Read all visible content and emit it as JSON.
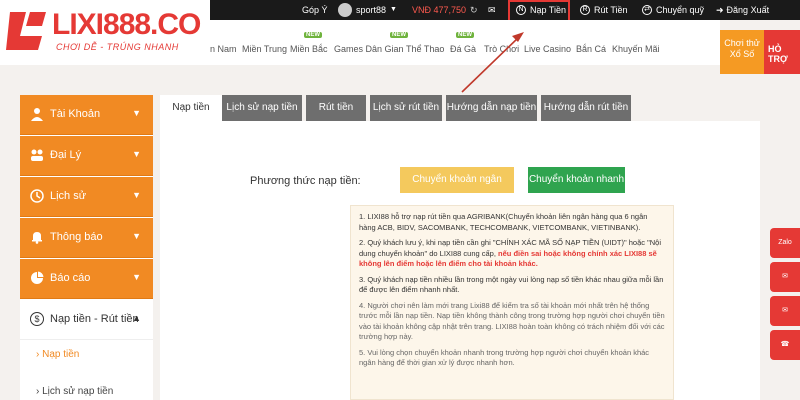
{
  "topbar": {
    "feedback": "Góp Ý",
    "username": "sport88",
    "balance": "VNĐ 477,750",
    "deposit": "Nạp Tiền",
    "withdraw": "Rút Tiền",
    "transfer": "Chuyển quỹ",
    "logout": "Đăng Xuất"
  },
  "logo": {
    "brand": "LIXI888.CO",
    "tagline": "CHƠI DỄ - TRÚNG NHANH"
  },
  "mainnav": {
    "items": [
      "n Nam",
      "Miền Trung",
      "Miền Bắc",
      "Games Dân Gian",
      "Thể Thao",
      "Đá Gà",
      "Trò Chơi",
      "Live Casino",
      "Bắn Cá",
      "Khuyến Mãi"
    ],
    "new_tag": "NEW"
  },
  "promo": {
    "tile1": "Chơi thử Xổ Số",
    "tile2": "HỎ TRỢ"
  },
  "sidebar": {
    "items": [
      "Tài Khoản",
      "Đại Lý",
      "Lịch sử",
      "Thông báo",
      "Báo cáo"
    ],
    "open_item": "Nạp tiền - Rút tiền",
    "sub_active": "Nạp tiền",
    "sub_next": "Lịch sử nạp tiền"
  },
  "tabs": {
    "active": "Nạp tiền",
    "items": [
      "Lịch sử nạp tiền",
      "Rút tiền",
      "Lịch sử rút tiền",
      "Hướng dẫn nạp tiền",
      "Hướng dẫn rút tiền"
    ]
  },
  "content": {
    "method_label": "Phương thức nạp tiền:",
    "btn_bank": "Chuyển khoản ngân hàng",
    "btn_fast": "Chuyển khoản nhanh",
    "notes": {
      "n1": "1. LIXI88 hỗ trợ nạp rút tiền qua AGRIBANK(Chuyển khoản liên ngân hàng qua 6 ngân hàng ACB, BIDV, SACOMBANK, TECHCOMBANK, VIETCOMBANK, VIETINBANK).",
      "n2a": "2. Quý khách lưu ý, khi nạp tiền cần ghi \"CHÍNH XÁC MÃ SỐ NẠP TIỀN (UIDT)\" hoặc \"Nội dung chuyển khoản\" do LIXI88 cung cấp, ",
      "n2b": "nếu điền sai hoặc không chính xác LIXI88 sẽ không lên điểm hoặc lên điểm cho tài khoản khác.",
      "n3": "3. Quý khách nạp tiền nhiều lần trong một ngày vui lòng nạp số tiền khác nhau giữa mỗi lần để được lên điểm nhanh nhất.",
      "n4": "4. Người chơi nên làm mới trang Lixi88 để kiểm tra số tài khoản mới nhất trên hệ thống trước mỗi lần nạp tiền. Nạp tiền không thành công trong trường hợp người chơi chuyển tiền vào tài khoản không cập nhật trên trang. LIXI88 hoàn toàn không có trách nhiệm đối với các trường hợp này.",
      "n5": "5. Vui lòng chọn chuyển khoản nhanh trong trường hợp người chơi chuyển khoản khác ngân hàng để thời gian xử lý được nhanh hơn."
    }
  },
  "floats": {
    "zalo": "Zalo"
  },
  "colors": {
    "orange": "#f18a23",
    "red": "#e53935",
    "green": "#2fa44f",
    "yellow": "#f4c95d",
    "tab_grey": "#6e6e6e"
  }
}
